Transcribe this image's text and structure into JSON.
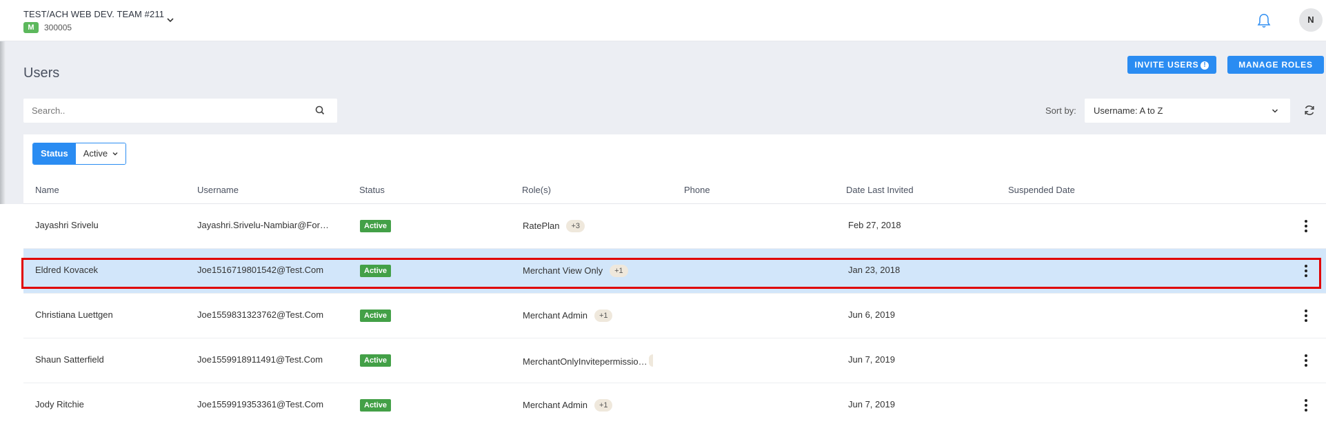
{
  "org": {
    "name": "TEST/ACH WEB DEV. TEAM #211",
    "badge": "M",
    "id": "300005"
  },
  "user": {
    "avatar_initial": "N"
  },
  "page": {
    "title": "Users"
  },
  "actions": {
    "invite_label": "INVITE USERS",
    "invite_alert": "!",
    "manage_roles_label": "MANAGE ROLES"
  },
  "search": {
    "placeholder": "Search.."
  },
  "sort": {
    "label": "Sort by:",
    "value": "Username: A to Z"
  },
  "filter": {
    "label": "Status",
    "value": "Active"
  },
  "columns": {
    "name": "Name",
    "username": "Username",
    "status": "Status",
    "roles": "Role(s)",
    "phone": "Phone",
    "date_last_invited": "Date Last Invited",
    "suspended_date": "Suspended Date"
  },
  "rows": [
    {
      "name": "Jayashri Srivelu",
      "username": "Jayashri.Srivelu-Nambiar@For…",
      "status": "Active",
      "role": "RatePlan",
      "role_more": "+3",
      "phone": "",
      "date_last_invited": "Feb 27, 2018",
      "suspended_date": ""
    },
    {
      "name": "Eldred Kovacek",
      "username": "Joe1516719801542@Test.Com",
      "status": "Active",
      "role": "Merchant View Only",
      "role_more": "+1",
      "phone": "",
      "date_last_invited": "Jan 23, 2018",
      "suspended_date": ""
    },
    {
      "name": "Christiana Luettgen",
      "username": "Joe1559831323762@Test.Com",
      "status": "Active",
      "role": "Merchant Admin",
      "role_more": "+1",
      "phone": "",
      "date_last_invited": "Jun 6, 2019",
      "suspended_date": ""
    },
    {
      "name": "Shaun Satterfield",
      "username": "Joe1559918911491@Test.Com",
      "status": "Active",
      "role": "MerchantOnlyInvitepermissio…",
      "role_more": "",
      "phone": "",
      "date_last_invited": "Jun 7, 2019",
      "suspended_date": ""
    },
    {
      "name": "Jody Ritchie",
      "username": "Joe1559919353361@Test.Com",
      "status": "Active",
      "role": "Merchant Admin",
      "role_more": "+1",
      "phone": "",
      "date_last_invited": "Jun 7, 2019",
      "suspended_date": ""
    }
  ],
  "selected_row_index": 1,
  "colors": {
    "primary": "#2a8cf2",
    "active_status": "#43a047",
    "org_badge": "#5cb85c",
    "selected_row": "#d2e6fa",
    "highlight_border": "#e00000"
  }
}
